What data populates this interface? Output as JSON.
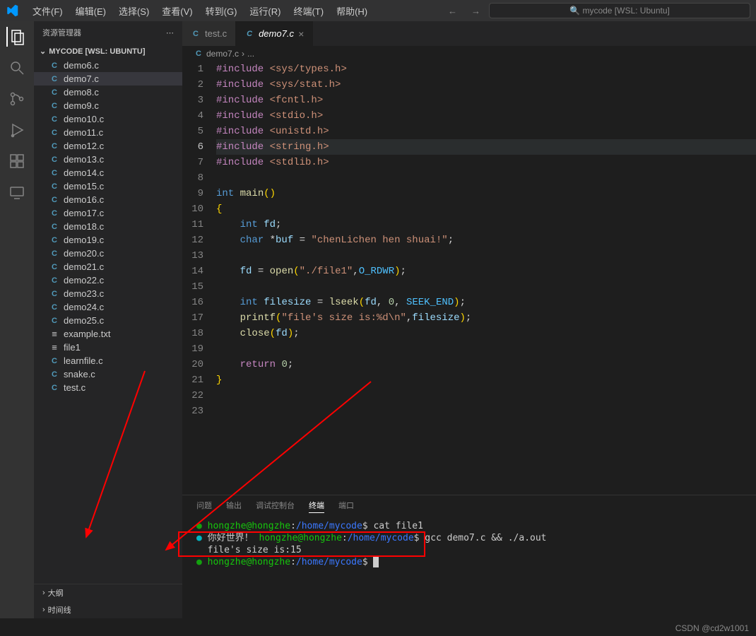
{
  "titlebar": {
    "menus": [
      "文件(F)",
      "编辑(E)",
      "选择(S)",
      "查看(V)",
      "转到(G)",
      "运行(R)",
      "终端(T)",
      "帮助(H)"
    ],
    "search_placeholder": "mycode [WSL: Ubuntu]"
  },
  "sidebar": {
    "title": "资源管理器",
    "section": "MYCODE [WSL: UBUNTU]",
    "files": [
      {
        "icon": "C",
        "name": "demo6.c",
        "type": "c"
      },
      {
        "icon": "C",
        "name": "demo7.c",
        "type": "c",
        "active": true
      },
      {
        "icon": "C",
        "name": "demo8.c",
        "type": "c"
      },
      {
        "icon": "C",
        "name": "demo9.c",
        "type": "c"
      },
      {
        "icon": "C",
        "name": "demo10.c",
        "type": "c"
      },
      {
        "icon": "C",
        "name": "demo11.c",
        "type": "c"
      },
      {
        "icon": "C",
        "name": "demo12.c",
        "type": "c"
      },
      {
        "icon": "C",
        "name": "demo13.c",
        "type": "c"
      },
      {
        "icon": "C",
        "name": "demo14.c",
        "type": "c"
      },
      {
        "icon": "C",
        "name": "demo15.c",
        "type": "c"
      },
      {
        "icon": "C",
        "name": "demo16.c",
        "type": "c"
      },
      {
        "icon": "C",
        "name": "demo17.c",
        "type": "c"
      },
      {
        "icon": "C",
        "name": "demo18.c",
        "type": "c"
      },
      {
        "icon": "C",
        "name": "demo19.c",
        "type": "c"
      },
      {
        "icon": "C",
        "name": "demo20.c",
        "type": "c"
      },
      {
        "icon": "C",
        "name": "demo21.c",
        "type": "c"
      },
      {
        "icon": "C",
        "name": "demo22.c",
        "type": "c"
      },
      {
        "icon": "C",
        "name": "demo23.c",
        "type": "c"
      },
      {
        "icon": "C",
        "name": "demo24.c",
        "type": "c"
      },
      {
        "icon": "C",
        "name": "demo25.c",
        "type": "c"
      },
      {
        "icon": "≡",
        "name": "example.txt",
        "type": "txt"
      },
      {
        "icon": "≡",
        "name": "file1",
        "type": "txt"
      },
      {
        "icon": "C",
        "name": "learnfile.c",
        "type": "c"
      },
      {
        "icon": "C",
        "name": "snake.c",
        "type": "c"
      },
      {
        "icon": "C",
        "name": "test.c",
        "type": "c"
      }
    ],
    "outline": "大纲",
    "timeline": "时间线"
  },
  "tabs": [
    {
      "icon": "C",
      "label": "test.c",
      "active": false
    },
    {
      "icon": "C",
      "label": "demo7.c",
      "active": true
    }
  ],
  "breadcrumb": [
    "C",
    "demo7.c",
    "›",
    "..."
  ],
  "code": {
    "current_line": 6,
    "lines": [
      {
        "n": 1,
        "html": "<span class='kw-include'>#include</span> <span class='kw-path'>&lt;sys/types.h&gt;</span>"
      },
      {
        "n": 2,
        "html": "<span class='kw-include'>#include</span> <span class='kw-path'>&lt;sys/stat.h&gt;</span>"
      },
      {
        "n": 3,
        "html": "<span class='kw-include'>#include</span> <span class='kw-path'>&lt;fcntl.h&gt;</span>"
      },
      {
        "n": 4,
        "html": "<span class='kw-include'>#include</span> <span class='kw-path'>&lt;stdio.h&gt;</span>"
      },
      {
        "n": 5,
        "html": "<span class='kw-include'>#include</span> <span class='kw-path'>&lt;unistd.h&gt;</span>"
      },
      {
        "n": 6,
        "html": "<span class='kw-include'>#include</span> <span class='kw-path'>&lt;string.h&gt;</span>"
      },
      {
        "n": 7,
        "html": "<span class='kw-include'>#include</span> <span class='kw-path'>&lt;stdlib.h&gt;</span>"
      },
      {
        "n": 8,
        "html": ""
      },
      {
        "n": 9,
        "html": "<span class='kw-type'>int</span> <span class='kw-func'>main</span><span class='brace'>()</span>"
      },
      {
        "n": 10,
        "html": "<span class='brace'>{</span>"
      },
      {
        "n": 11,
        "html": "    <span class='kw-type'>int</span> <span class='kw-var'>fd</span><span class='plain'>;</span>"
      },
      {
        "n": 12,
        "html": "    <span class='kw-type'>char</span> <span class='plain'>*</span><span class='kw-var'>buf</span> <span class='plain'>=</span> <span class='kw-str'>\"chenLichen hen shuai!\"</span><span class='plain'>;</span>"
      },
      {
        "n": 13,
        "html": ""
      },
      {
        "n": 14,
        "html": "    <span class='kw-var'>fd</span> <span class='plain'>=</span> <span class='kw-func'>open</span><span class='brace'>(</span><span class='kw-str'>\"./file1\"</span><span class='plain'>,</span><span class='kw-const'>O_RDWR</span><span class='brace'>)</span><span class='plain'>;</span>"
      },
      {
        "n": 15,
        "html": ""
      },
      {
        "n": 16,
        "html": "    <span class='kw-type'>int</span> <span class='kw-var'>filesize</span> <span class='plain'>=</span> <span class='kw-func'>lseek</span><span class='brace'>(</span><span class='kw-var'>fd</span><span class='plain'>,</span> <span class='kw-num'>0</span><span class='plain'>,</span> <span class='kw-const'>SEEK_END</span><span class='brace'>)</span><span class='plain'>;</span>"
      },
      {
        "n": 17,
        "html": "    <span class='kw-func'>printf</span><span class='brace'>(</span><span class='kw-str'>\"file's size is:%d\\n\"</span><span class='plain'>,</span><span class='kw-var'>filesize</span><span class='brace'>)</span><span class='plain'>;</span>"
      },
      {
        "n": 18,
        "html": "    <span class='kw-func'>close</span><span class='brace'>(</span><span class='kw-var'>fd</span><span class='brace'>)</span><span class='plain'>;</span>"
      },
      {
        "n": 19,
        "html": ""
      },
      {
        "n": 20,
        "html": "    <span class='kw-ret'>return</span> <span class='kw-num'>0</span><span class='plain'>;</span>"
      },
      {
        "n": 21,
        "html": "<span class='brace'>}</span>"
      },
      {
        "n": 22,
        "html": ""
      },
      {
        "n": 23,
        "html": ""
      }
    ]
  },
  "panel": {
    "tabs": [
      "问题",
      "输出",
      "调试控制台",
      "终端",
      "端口"
    ],
    "active_tab": "终端",
    "terminal_lines": [
      {
        "type": "prompt",
        "user": "hongzhe@hongzhe",
        "path": "/home/mycode",
        "cmd": "cat file1",
        "dot": "green"
      },
      {
        "type": "out-prompt",
        "out": "你好世界！",
        "user": "hongzhe@hongzhe",
        "path": "/home/mycode",
        "cmd": "gcc demo7.c && ./a.out",
        "dot": "cyan"
      },
      {
        "type": "out",
        "text": "file's size is:15"
      },
      {
        "type": "prompt",
        "user": "hongzhe@hongzhe",
        "path": "/home/mycode",
        "cmd": "",
        "dot": "green",
        "cursor": true
      }
    ]
  },
  "watermark": "CSDN @cd2w1001"
}
